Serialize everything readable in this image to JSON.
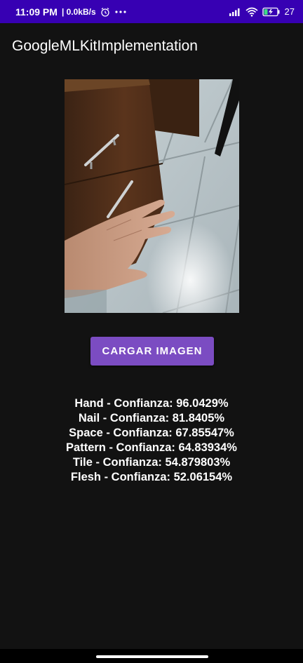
{
  "status_bar": {
    "time": "11:09 PM",
    "speed": "| 0.0kB/s",
    "battery": "27"
  },
  "app_bar": {
    "title": "GoogleMLKitImplementation"
  },
  "button": {
    "label": "CARGAR IMAGEN"
  },
  "results": [
    "Hand - Confianza: 96.0429%",
    "Nail - Confianza: 81.8405%",
    "Space - Confianza: 67.85547%",
    "Pattern - Confianza: 64.83934%",
    "Tile - Confianza: 54.879803%",
    "Flesh - Confianza: 52.06154%"
  ],
  "colors": {
    "status_bar": "#3700b3",
    "background": "#121212",
    "button": "#7b4cc2"
  }
}
